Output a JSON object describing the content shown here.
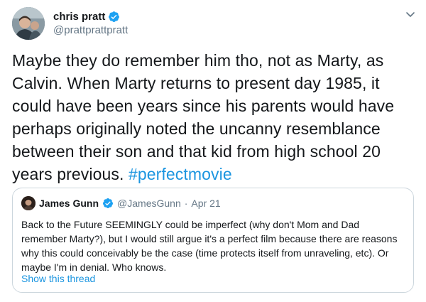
{
  "author": {
    "display_name": "chris pratt",
    "handle": "@prattprattpratt",
    "verified": true
  },
  "tweet": {
    "text": "Maybe they do remember him tho, not as Marty, as Calvin. When Marty returns to present day 1985, it could have been years since his parents would have perhaps originally noted the uncanny resemblance between their son and that kid from high school 20 years previous. ",
    "hashtag": "#perfectmovie"
  },
  "quoted_tweet": {
    "display_name": "James Gunn",
    "handle": "@JamesGunn",
    "separator": "·",
    "date": "Apr 21",
    "verified": true,
    "text": "Back to the Future SEEMINGLY could be imperfect (why don't Mom and Dad remember Marty?), but I would still argue it's a perfect film because there are reasons why this could conceivably be the case (time protects itself from unraveling, etc). Or maybe I'm in denial. Who knows.",
    "thread_link": "Show this thread"
  },
  "icons": {
    "verified": "verified-badge-icon",
    "more": "chevron-down-icon"
  },
  "colors": {
    "link": "#1b95e0",
    "verified": "#1da1f2",
    "secondary_text": "#657786",
    "border": "#ccd6dd"
  }
}
